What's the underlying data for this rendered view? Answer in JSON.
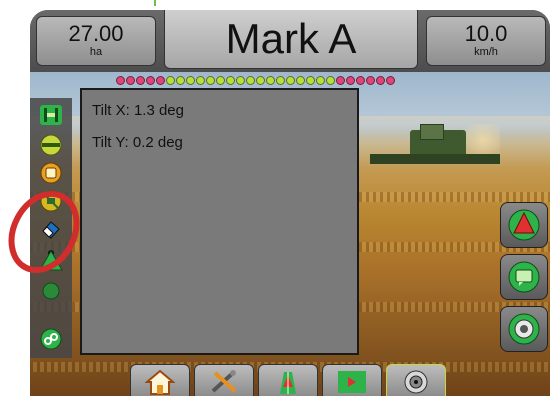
{
  "header": {
    "area_value": "27.00",
    "area_unit": "ha",
    "title": "Mark A",
    "speed_value": "10.0",
    "speed_unit": "km/h"
  },
  "panel": {
    "tilt_x": "Tilt X: 1.3 deg",
    "tilt_y": "Tilt Y: 0.2 deg"
  },
  "lightbar": {
    "leds": [
      "pink",
      "pink",
      "pink",
      "pink",
      "pink",
      "green",
      "green",
      "green",
      "green",
      "green",
      "green",
      "green",
      "green",
      "green",
      "green",
      "green",
      "green",
      "green",
      "green",
      "green",
      "green",
      "green",
      "pink",
      "pink",
      "pink",
      "pink",
      "pink",
      "pink"
    ],
    "colors": {
      "pink": "#e0457a",
      "green": "#b7df3c"
    }
  },
  "left_tools": [
    {
      "icon": "guidance-line-icon"
    },
    {
      "icon": "boundary-icon"
    },
    {
      "icon": "marker-icon"
    },
    {
      "icon": "satellite-icon"
    },
    {
      "icon": "eraser-icon"
    },
    {
      "icon": "vehicle-position-icon"
    },
    {
      "icon": "zoom-icon"
    },
    {
      "icon": "map-options-icon"
    }
  ],
  "right_buttons": [
    {
      "icon": "vehicle-view-icon"
    },
    {
      "icon": "field-view-icon"
    },
    {
      "icon": "tilt-gauge-icon"
    }
  ],
  "nav_buttons": [
    {
      "icon": "home-icon"
    },
    {
      "icon": "settings-tools-icon"
    },
    {
      "icon": "vehicle-guidance-icon"
    },
    {
      "icon": "field-guidance-icon"
    },
    {
      "icon": "gauge-icon"
    }
  ],
  "colors": {
    "annotation": "#d12d2d",
    "accent_green": "#2db34a"
  }
}
